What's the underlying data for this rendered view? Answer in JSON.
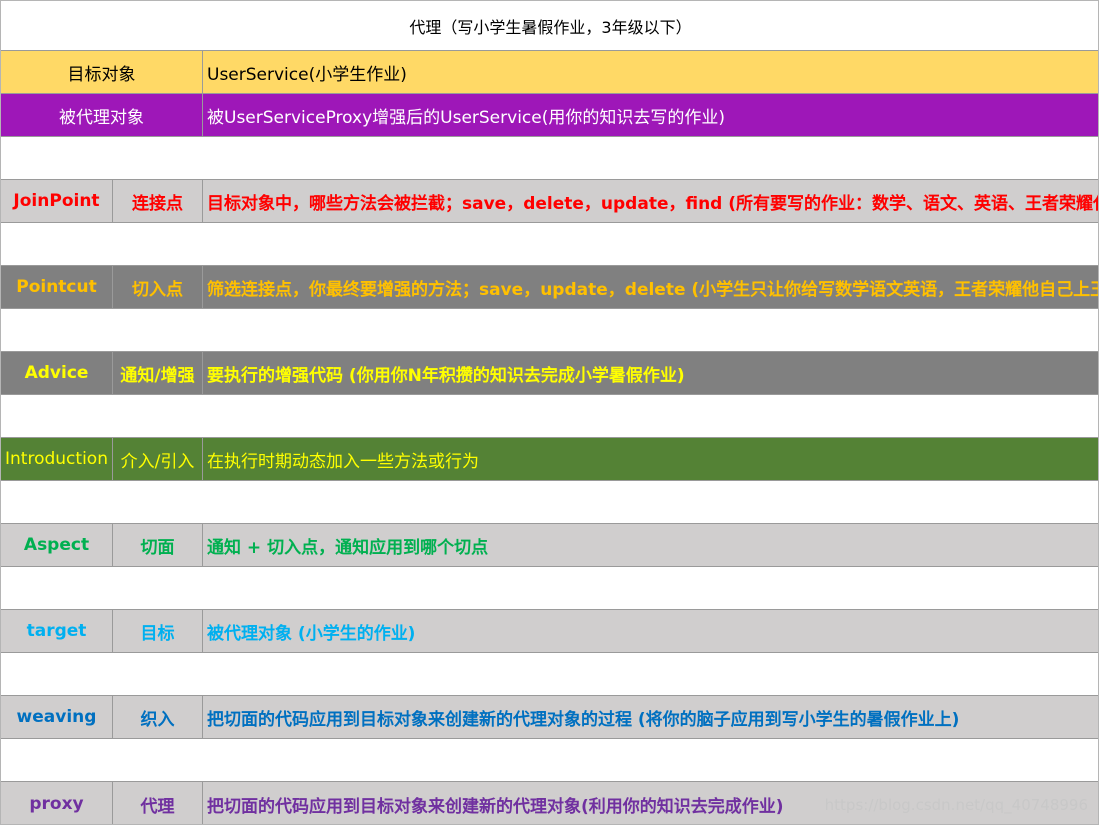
{
  "title": "代理（写小学生暑假作业，3年级以下）",
  "target_row": {
    "label": "目标对象",
    "value": "UserService(小学生作业)",
    "bg": "#ffd966"
  },
  "proxied_row": {
    "label": "被代理对象",
    "value": "被UserServiceProxy增强后的UserService(用你的知识去写的作业)",
    "bg": "#9e17b8",
    "fg": "#ffffff"
  },
  "concepts": [
    {
      "term": "JoinPoint",
      "cn": "连接点",
      "desc": "目标对象中，哪些方法会被拦截；save，delete，update，find (所有要写的作业：数学、语文、英语、王者荣耀代上",
      "bg": "#d0cece",
      "fg": "#ff0000",
      "bold": true
    },
    {
      "term": "Pointcut",
      "cn": "切入点",
      "desc": "筛选连接点，你最终要增强的方法；save，update，delete (小学生只让你给写数学语文英语，王者荣耀他自己上王者",
      "bg": "#808080",
      "fg": "#ffc000",
      "bold": true
    },
    {
      "term": "Advice",
      "cn": "通知/增强",
      "desc": "要执行的增强代码 (你用你N年积攒的知识去完成小学暑假作业)",
      "bg": "#808080",
      "fg": "#ffff00",
      "bold": true
    },
    {
      "term": "Introduction",
      "cn": "介入/引入",
      "desc": "在执行时期动态加入一些方法或行为",
      "bg": "#548235",
      "fg": "#ffff00",
      "bold": false
    },
    {
      "term": "Aspect",
      "cn": "切面",
      "desc": "通知 + 切入点，通知应用到哪个切点",
      "bg": "#d0cece",
      "fg": "#00b050",
      "bold": true
    },
    {
      "term": "target",
      "cn": "目标",
      "desc": "被代理对象 (小学生的作业)",
      "bg": "#d0cece",
      "fg": "#00b0f0",
      "bold": true
    },
    {
      "term": "weaving",
      "cn": "织入",
      "desc": "把切面的代码应用到目标对象来创建新的代理对象的过程 (将你的脑子应用到写小学生的暑假作业上)",
      "bg": "#d0cece",
      "fg": "#0070c0",
      "bold": true
    },
    {
      "term": "proxy",
      "cn": "代理",
      "desc": "把切面的代码应用到目标对象来创建新的代理对象(利用你的知识去完成作业)",
      "bg": "#d0cece",
      "fg": "#7030a0",
      "bold": true
    }
  ],
  "watermark": "https://blog.csdn.net/qq_40748996"
}
